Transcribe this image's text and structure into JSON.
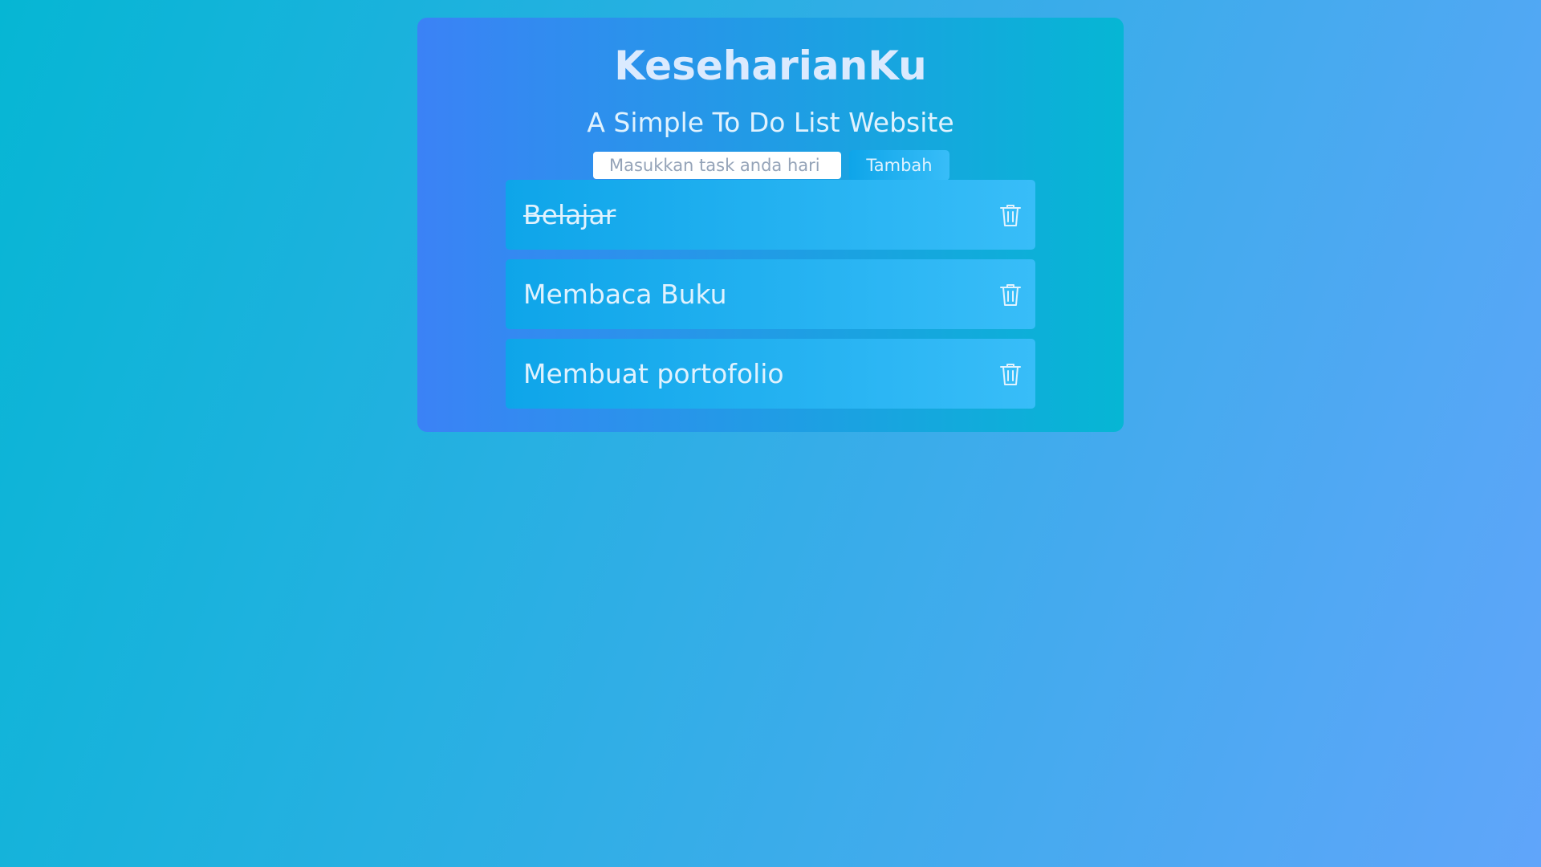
{
  "header": {
    "title": "KeseharianKu",
    "subtitle": "A Simple To Do List Website"
  },
  "form": {
    "input_value": "",
    "input_placeholder": "Masukkan task anda hari ini",
    "add_label": "Tambah"
  },
  "todos": [
    {
      "text": "Belajar",
      "completed": true,
      "delete_icon": "trash-icon"
    },
    {
      "text": "Membaca Buku",
      "completed": false,
      "delete_icon": "trash-icon"
    },
    {
      "text": "Membuat portofolio",
      "completed": false,
      "delete_icon": "trash-icon"
    }
  ],
  "colors": {
    "background_start": "#06b6d4",
    "background_end": "#60a5fa",
    "card_start": "#3b82f6",
    "card_end": "#06b6d4",
    "item_start": "#0ea5e9",
    "item_end": "#38bdf8",
    "text": "#e0f2fe"
  }
}
